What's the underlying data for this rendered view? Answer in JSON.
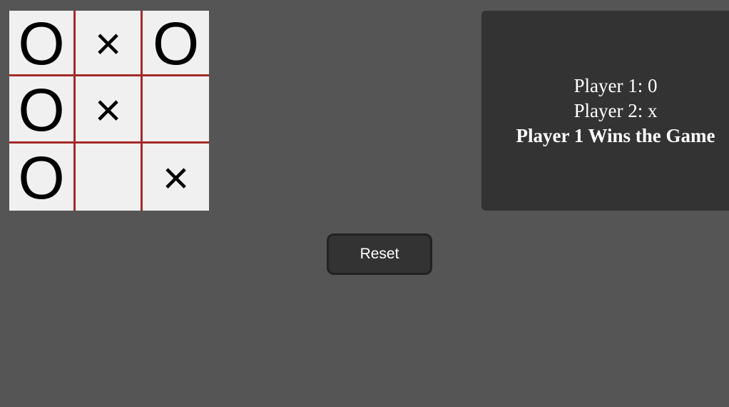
{
  "board": {
    "cells": [
      [
        "O",
        "×",
        "O"
      ],
      [
        "O",
        "×",
        ""
      ],
      [
        "O",
        "",
        "×"
      ]
    ],
    "grid_line_color": "#a52a2a",
    "background_color": "#f0f0f0"
  },
  "info": {
    "player1": "Player 1: 0",
    "player2": "Player 2: x",
    "result": "Player 1 Wins the Game"
  },
  "controls": {
    "reset_label": "Reset"
  },
  "colors": {
    "page_background": "#555555",
    "panel_background": "#333333",
    "button_background": "#333333",
    "text": "#ffffff"
  }
}
